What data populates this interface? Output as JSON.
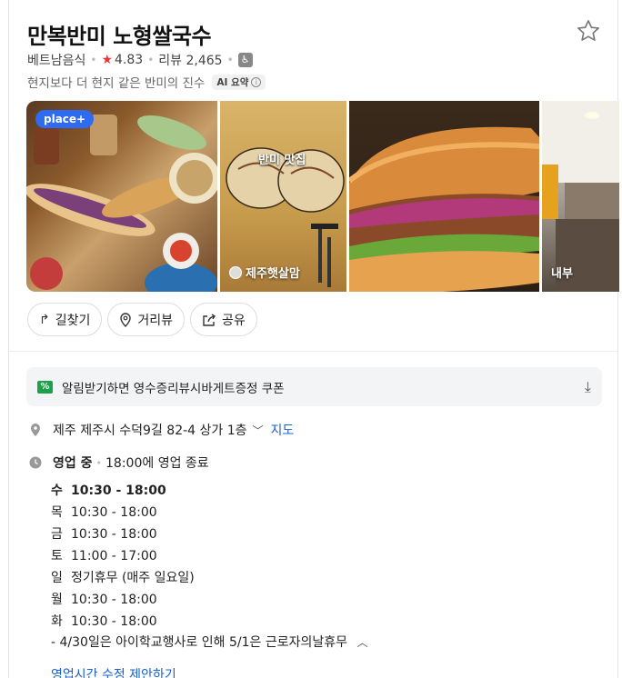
{
  "place": {
    "name": "만복반미 노형쌀국수",
    "category": "베트남음식",
    "rating": "4.83",
    "reviews_label": "리뷰 2,465",
    "description": "현지보다 더 현지 같은 반미의 진수",
    "ai_label": "AI 요약"
  },
  "gallery": {
    "badge": "place+",
    "caption2": "제주햇살맘",
    "caption4": "내부",
    "sign_text": "반미 맛집"
  },
  "actions": {
    "directions": "길찾기",
    "streetview": "거리뷰",
    "share": "공유"
  },
  "coupon": {
    "text": "알림받기하면 영수증리뷰시바게트증정 쿠폰"
  },
  "address": {
    "text": "제주 제주시 수덕9길 82-4 상가 1층",
    "map_link": "지도"
  },
  "status": {
    "state": "영업 중",
    "close_text": "18:00에 영업 종료"
  },
  "hours": [
    {
      "day": "수",
      "time": "10:30 - 18:00"
    },
    {
      "day": "목",
      "time": "10:30 - 18:00"
    },
    {
      "day": "금",
      "time": "10:30 - 18:00"
    },
    {
      "day": "토",
      "time": "11:00 - 17:00"
    },
    {
      "day": "일",
      "time": "정기휴무 (매주 일요일)"
    },
    {
      "day": "월",
      "time": "10:30 - 18:00"
    },
    {
      "day": "화",
      "time": "10:30 - 18:00"
    }
  ],
  "note": "- 4/30일은 아이학교행사로 인해 5/1은 근로자의날휴무",
  "suggest_link": "영업시간 수정 제안하기",
  "colors": {
    "accent_blue": "#1a5fd0",
    "rating_star": "#ee3333",
    "coupon_green": "#1ea04a",
    "place_badge": "#2e6bf0"
  }
}
